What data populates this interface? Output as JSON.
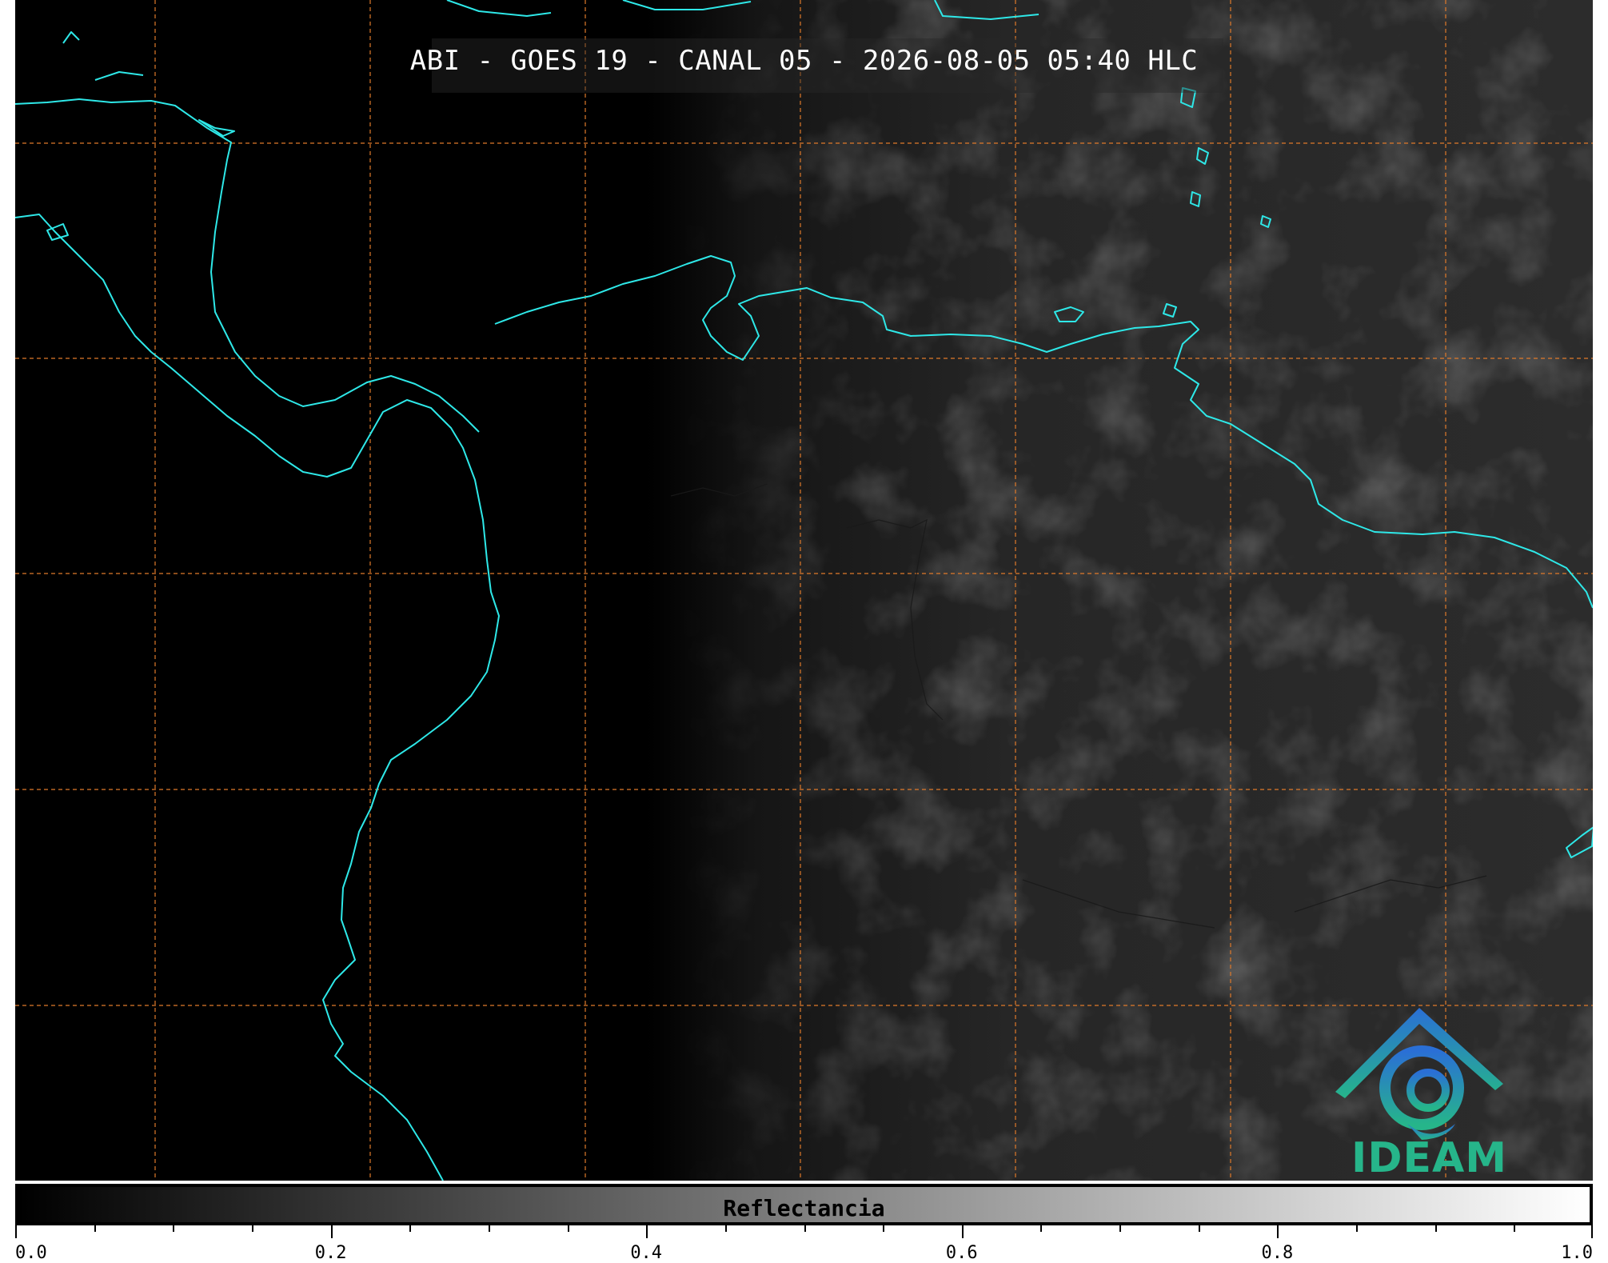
{
  "title": "ABI - GOES 19 - CANAL 05 - 2026-08-05 05:40 HLC",
  "colorbar": {
    "label": "Reflectancia",
    "cmap": [
      "#000000",
      "#ffffff"
    ],
    "range": [
      0.0,
      1.0
    ],
    "major_ticks": [
      "0.0",
      "0.2",
      "0.4",
      "0.6",
      "0.8",
      "1.0"
    ],
    "minor_tick_count": 20
  },
  "map": {
    "background": "#000000",
    "coastline_color": "#2ee8e8",
    "grid_color": "#e07a2a",
    "grid_style": "dashed",
    "illumination": "night-to-day terminator, image brighter toward the east"
  },
  "logo": {
    "text": "IDEAM",
    "colors": [
      "#2a6fd6",
      "#26b58a"
    ]
  }
}
